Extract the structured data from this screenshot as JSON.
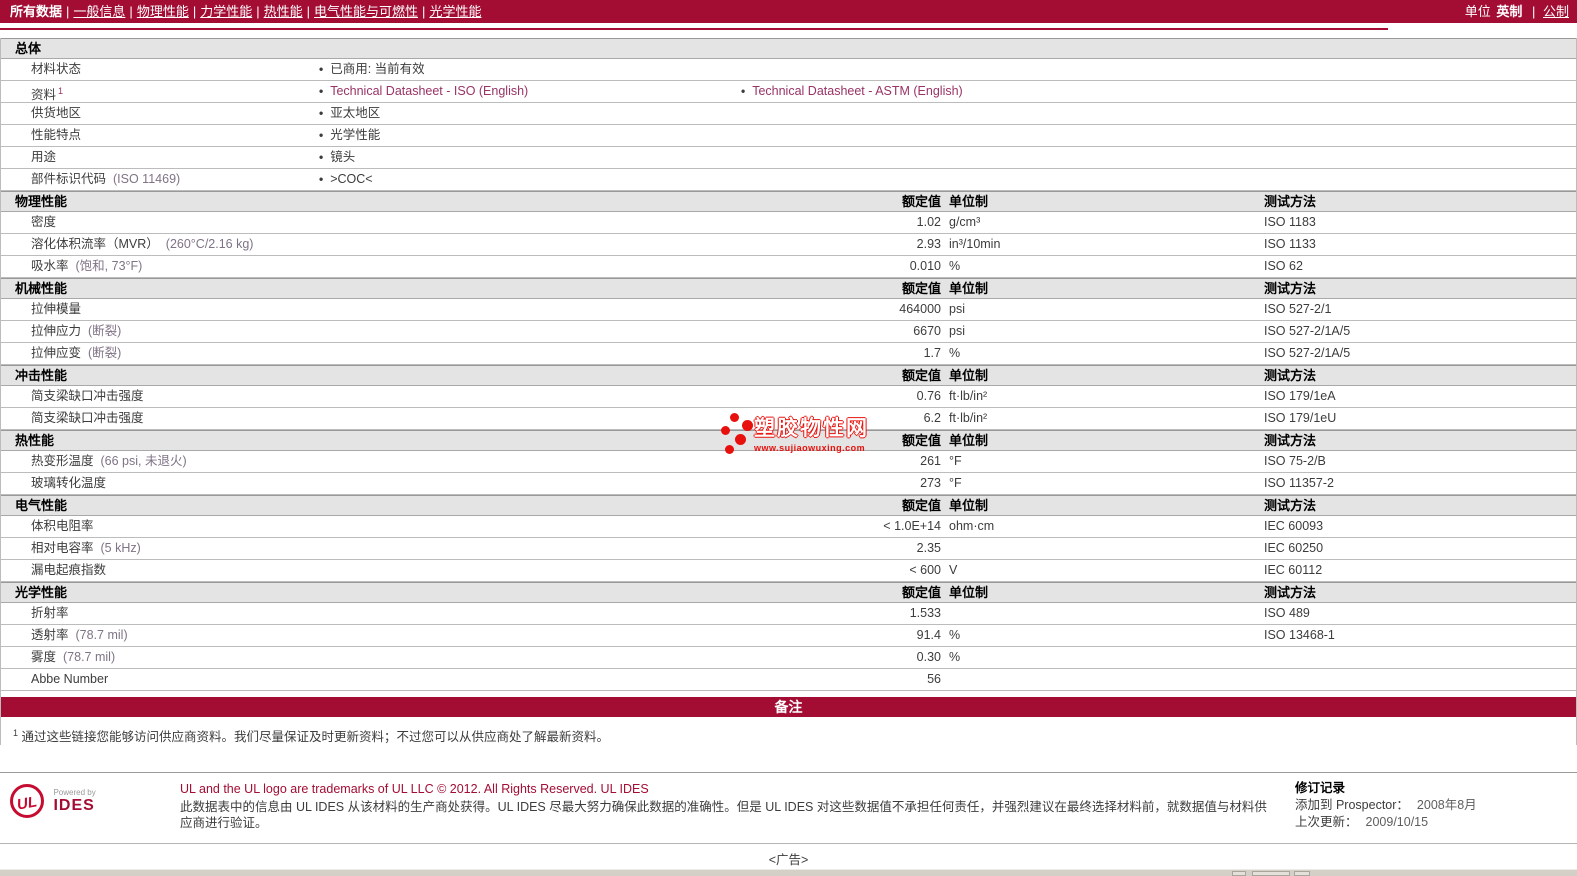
{
  "nav": {
    "items": [
      {
        "label": "所有数据",
        "active": true
      },
      {
        "label": "一般信息"
      },
      {
        "label": "物理性能"
      },
      {
        "label": "力学性能"
      },
      {
        "label": "热性能"
      },
      {
        "label": "电气性能与可燃性"
      },
      {
        "label": "光学性能"
      }
    ],
    "units_label": "单位",
    "unit_active": "英制",
    "unit_alt": "公制"
  },
  "columns": {
    "value": "额定值",
    "unit": "单位制",
    "method": "测试方法"
  },
  "general": {
    "title": "总体",
    "rows": [
      {
        "label": "材料状态",
        "bullets": [
          {
            "text": "已商用: 当前有效"
          }
        ]
      },
      {
        "label": "资料",
        "sup": "1",
        "bullets": [
          {
            "text": "Technical Datasheet - ISO (English)",
            "link": true
          },
          {
            "text": "Technical Datasheet - ASTM (English)",
            "link": true
          }
        ]
      },
      {
        "label": "供货地区",
        "bullets": [
          {
            "text": "亚太地区"
          }
        ]
      },
      {
        "label": "性能特点",
        "bullets": [
          {
            "text": "光学性能"
          }
        ]
      },
      {
        "label": "用途",
        "bullets": [
          {
            "text": "镜头"
          }
        ]
      },
      {
        "label": "部件标识代码",
        "condition": "(ISO 11469)",
        "bullets": [
          {
            "text": ">COC<"
          }
        ]
      }
    ]
  },
  "sections": [
    {
      "title": "物理性能",
      "rows": [
        {
          "label": "密度",
          "condition": "",
          "value": "1.02",
          "unit": "g/cm³",
          "method": "ISO 1183"
        },
        {
          "label": "溶化体积流率（MVR）",
          "condition": "(260°C/2.16 kg)",
          "value": "2.93",
          "unit": "in³/10min",
          "method": "ISO 1133"
        },
        {
          "label": "吸水率",
          "condition": "(饱和, 73°F)",
          "value": "0.010",
          "unit": "%",
          "method": "ISO 62"
        }
      ]
    },
    {
      "title": "机械性能",
      "rows": [
        {
          "label": "拉伸模量",
          "condition": "",
          "value": "464000",
          "unit": "psi",
          "method": "ISO 527-2/1"
        },
        {
          "label": "拉伸应力",
          "condition": "(断裂)",
          "value": "6670",
          "unit": "psi",
          "method": "ISO 527-2/1A/5"
        },
        {
          "label": "拉伸应变",
          "condition": "(断裂)",
          "value": "1.7",
          "unit": "%",
          "method": "ISO 527-2/1A/5"
        }
      ]
    },
    {
      "title": "冲击性能",
      "rows": [
        {
          "label": "简支梁缺口冲击强度",
          "condition": "",
          "value": "0.76",
          "unit": "ft·lb/in²",
          "method": "ISO 179/1eA"
        },
        {
          "label": "简支梁缺口冲击强度",
          "condition": "",
          "value": "6.2",
          "unit": "ft·lb/in²",
          "method": "ISO 179/1eU"
        }
      ]
    },
    {
      "title": "热性能",
      "rows": [
        {
          "label": "热变形温度",
          "condition": "(66 psi, 未退火)",
          "value": "261",
          "unit": "°F",
          "method": "ISO 75-2/B"
        },
        {
          "label": "玻璃转化温度",
          "condition": "",
          "value": "273",
          "unit": "°F",
          "method": "ISO 11357-2"
        }
      ]
    },
    {
      "title": "电气性能",
      "rows": [
        {
          "label": "体积电阻率",
          "condition": "",
          "value": "< 1.0E+14",
          "unit": "ohm·cm",
          "method": "IEC 60093"
        },
        {
          "label": "相对电容率",
          "condition": "(5 kHz)",
          "value": "2.35",
          "unit": "",
          "method": "IEC 60250"
        },
        {
          "label": "漏电起痕指数",
          "condition": "",
          "value": "< 600",
          "unit": "V",
          "method": "IEC 60112"
        }
      ]
    },
    {
      "title": "光学性能",
      "rows": [
        {
          "label": "折射率",
          "condition": "",
          "value": "1.533",
          "unit": "",
          "method": "ISO 489"
        },
        {
          "label": "透射率",
          "condition": "(78.7 mil)",
          "value": "91.4",
          "unit": "%",
          "method": "ISO 13468-1"
        },
        {
          "label": "雾度",
          "condition": "(78.7 mil)",
          "value": "0.30",
          "unit": "%",
          "method": ""
        },
        {
          "label": "Abbe Number",
          "condition": "",
          "value": "56",
          "unit": "",
          "method": ""
        }
      ]
    }
  ],
  "notes": {
    "bar": "备注",
    "sup": "1",
    "text": "通过这些链接您能够访问供应商资料。我们尽量保证及时更新资料；不过您可以从供应商处了解最新资料。"
  },
  "watermark": {
    "name": "塑胶物性网",
    "url": "www.sujiaowuxing.com"
  },
  "footer": {
    "logo_text": "UL",
    "powered_by": "Powered by",
    "brand": "IDES",
    "line1": "UL and the UL logo are trademarks of UL LLC © 2012. All Rights Reserved. UL IDES",
    "line2": "此数据表中的信息由  UL IDES 从该材料的生产商处获得。UL IDES 尽最大努力确保此数据的准确性。但是  UL IDES 对这些数据值不承担任何责任，并强烈建议在最终选择材料前，就数据值与材料供应商进行验证。",
    "revision": {
      "title": "修订记录",
      "added_label": "添加到  Prospector：",
      "added_value": "2008年8月",
      "updated_label": "上次更新：",
      "updated_value": "2009/10/15"
    }
  },
  "ad": {
    "label": "<广告>"
  },
  "colors": {
    "nav_red": "#A30D34",
    "link_purple": "#993366",
    "watermark_red": "#E8100C",
    "section_bg": "#E4E4E4",
    "taskbar_gray": "#D4D0C8",
    "ul_red": "#C60C30"
  }
}
